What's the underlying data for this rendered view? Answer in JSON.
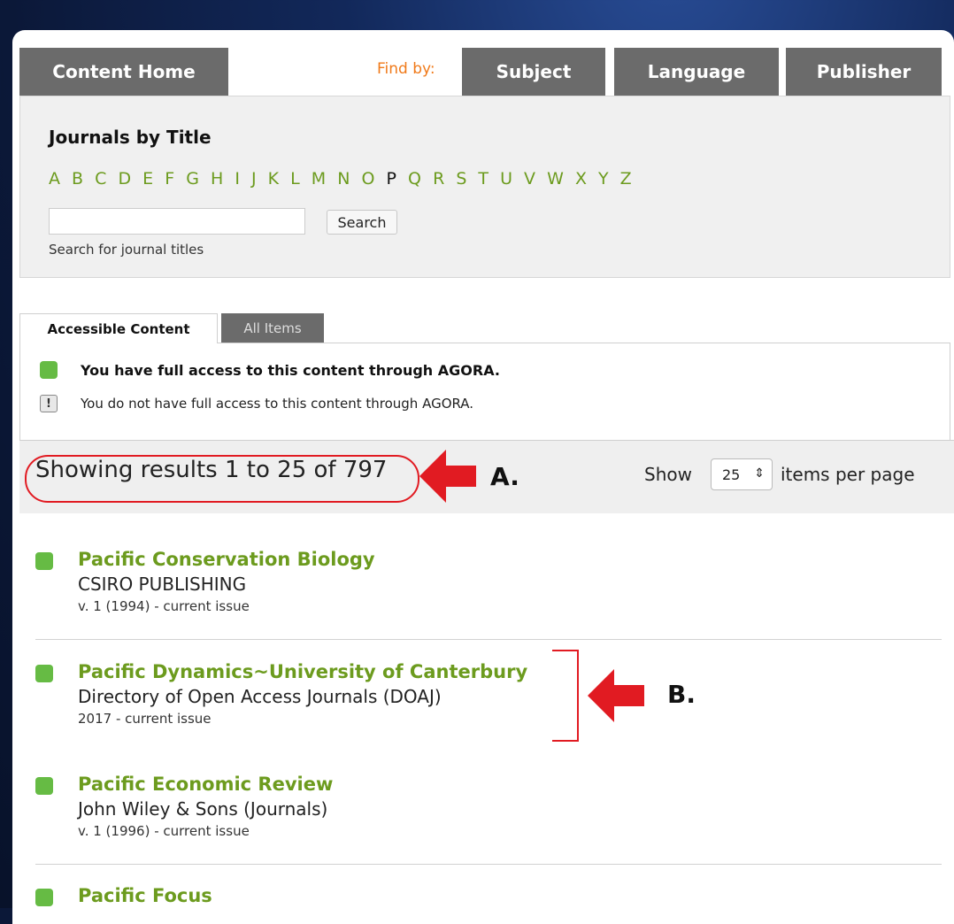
{
  "nav": {
    "content_home": "Content Home",
    "find_by": "Find by:",
    "subject": "Subject",
    "language": "Language",
    "publisher": "Publisher"
  },
  "title_search": {
    "heading": "Journals by Title",
    "letters": [
      "A",
      "B",
      "C",
      "D",
      "E",
      "F",
      "G",
      "H",
      "I",
      "J",
      "K",
      "L",
      "M",
      "N",
      "O",
      "P",
      "Q",
      "R",
      "S",
      "T",
      "U",
      "V",
      "W",
      "X",
      "Y",
      "Z"
    ],
    "active_letter": "P",
    "search_value": "",
    "search_button": "Search",
    "hint": "Search for journal titles"
  },
  "content_tabs": {
    "accessible": "Accessible Content",
    "all_items": "All Items"
  },
  "legend": {
    "full_access": "You have full access to this content through AGORA.",
    "no_full_access": "You do not have full access to this content through AGORA."
  },
  "results": {
    "summary": "Showing results 1 to 25 of 797",
    "show_label": "Show",
    "per_page_value": "25",
    "per_page_suffix": "items per page"
  },
  "annotations": {
    "a": "A.",
    "b": "B."
  },
  "items": [
    {
      "title": "Pacific Conservation Biology",
      "publisher": "CSIRO PUBLISHING",
      "coverage": "v. 1 (1994) - current issue"
    },
    {
      "title": "Pacific Dynamics~University of Canterbury",
      "publisher": "Directory of Open Access Journals (DOAJ)",
      "coverage": "2017 - current issue"
    },
    {
      "title": "Pacific Economic Review",
      "publisher": "John Wiley & Sons (Journals)",
      "coverage": "v. 1 (1996) - current issue"
    },
    {
      "title": "Pacific Focus",
      "publisher": "",
      "coverage": ""
    }
  ],
  "colors": {
    "accent_green": "#6c9b1e",
    "access_green": "#66bb44",
    "tab_gray": "#6b6b6b",
    "find_by_orange": "#f07a1a",
    "annotation_red": "#e11b22"
  }
}
